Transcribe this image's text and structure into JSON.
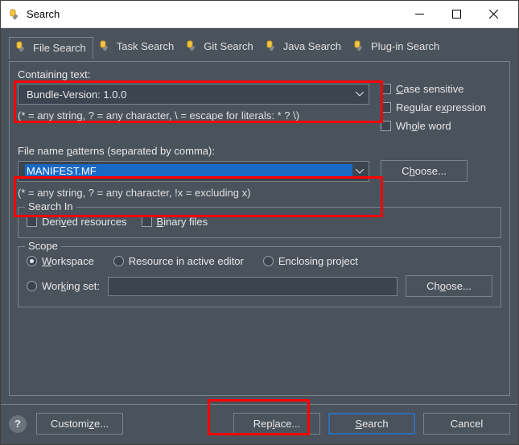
{
  "window": {
    "title": "Search"
  },
  "tabs": {
    "file": "File Search",
    "task": "Task Search",
    "git": "Git Search",
    "java": "Java Search",
    "plugin": "Plug-in Search"
  },
  "containing": {
    "label": "Containing text:",
    "value": "Bundle-Version: 1.0.0",
    "hint": "(* = any string, ? = any character, \\ = escape for literals: * ? \\)"
  },
  "options": {
    "case": "Case sensitive",
    "regex": "Regular expression",
    "whole": "Whole word"
  },
  "filename": {
    "label": "File name patterns (separated by comma):",
    "value": "MANIFEST.MF",
    "choose": "Choose...",
    "hint": "(* = any string, ? = any character, !x = excluding x)"
  },
  "searchin": {
    "title": "Search In",
    "derived": "Derived resources",
    "binary": "Binary files"
  },
  "scope": {
    "title": "Scope",
    "workspace": "Workspace",
    "editor": "Resource in active editor",
    "enclosing": "Enclosing project",
    "workingset": "Working set:",
    "choose": "Choose..."
  },
  "buttons": {
    "customize": "Customize...",
    "replace": "Replace...",
    "search": "Search",
    "cancel": "Cancel"
  }
}
